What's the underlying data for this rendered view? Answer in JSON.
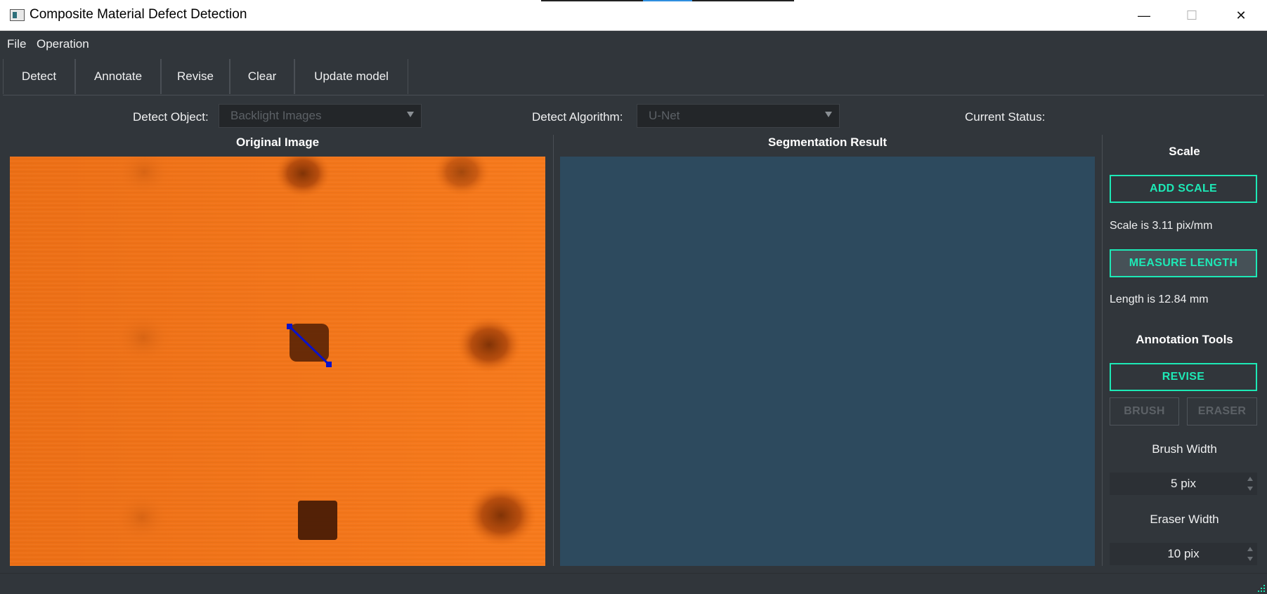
{
  "window": {
    "title": "Composite Material Defect Detection",
    "minimize_icon": "minimize-icon",
    "maximize_icon": "maximize-icon",
    "close_icon": "close-icon",
    "minimize_glyph": "—",
    "maximize_glyph": "☐",
    "close_glyph": "✕"
  },
  "menu": {
    "file": "File",
    "operation": "Operation"
  },
  "toolbar": {
    "detect": "Detect",
    "annotate": "Annotate",
    "revise": "Revise",
    "clear": "Clear",
    "update_model": "Update model"
  },
  "controls": {
    "detect_object_label": "Detect Object:",
    "detect_object_value": "Backlight Images",
    "detect_algorithm_label": "Detect Algorithm:",
    "detect_algorithm_value": "U-Net",
    "current_status_label": "Current Status:"
  },
  "panels": {
    "original_title": "Original Image",
    "segmentation_title": "Segmentation Result"
  },
  "side": {
    "scale_heading": "Scale",
    "add_scale": "ADD SCALE",
    "scale_text": "Scale is 3.11 pix/mm",
    "measure_length": "MEASURE LENGTH",
    "length_text": "Length is 12.84 mm",
    "annotation_heading": "Annotation Tools",
    "revise": "REVISE",
    "brush": "BRUSH",
    "eraser": "ERASER",
    "brush_width_label": "Brush Width",
    "brush_width_value": "5 pix",
    "eraser_width_label": "Eraser Width",
    "eraser_width_value": "10 pix"
  },
  "colors": {
    "accent": "#1de9b6",
    "background": "#31363b",
    "image_orange": "#f47418",
    "segmentation_bg": "#2d4a5e",
    "measure_line": "#0a12c8"
  }
}
